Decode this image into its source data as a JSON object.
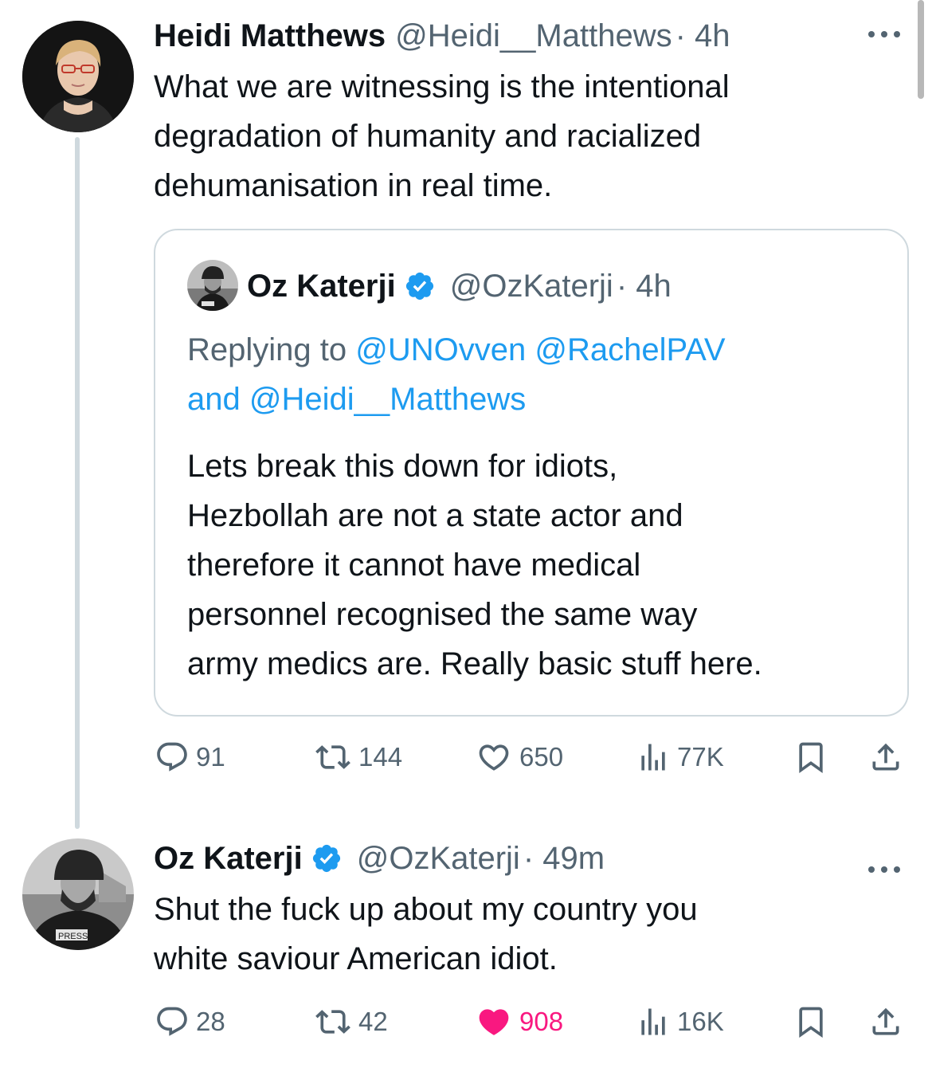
{
  "tweet1": {
    "display_name": "Heidi Matthews",
    "handle": "@Heidi__Matthews",
    "time": "· 4h",
    "more_icon": "more-horizontal-icon",
    "text_lines": [
      "What we are witnessing is the intentional",
      "degradation of humanity and racialized",
      "dehumanisation in real time."
    ],
    "quote": {
      "display_name": "Oz Katerji",
      "handle": "@OzKaterji",
      "time": "· 4h",
      "verified_icon": "verified-badge-icon",
      "replying_prefix": "Replying to",
      "replying_to_line1": "@UNOvven @RachelPAV",
      "replying_and": "and",
      "replying_to_line2": "@Heidi__Matthews",
      "text_lines": [
        "Lets break this down for idiots,",
        "Hezbollah are not a state actor and",
        "therefore it cannot have medical",
        "personnel recognised the same way",
        "army medics are. Really basic stuff here."
      ]
    },
    "metrics": {
      "replies": "91",
      "reposts": "144",
      "likes": "650",
      "views": "77K"
    }
  },
  "tweet2": {
    "display_name": "Oz Katerji",
    "handle": "@OzKaterji",
    "time": "· 49m",
    "verified_icon": "verified-badge-icon",
    "more_icon": "more-horizontal-icon",
    "avatar_badge": "PRESS",
    "text_lines": [
      "Shut the fuck up about my country you",
      "white saviour American idiot."
    ],
    "metrics": {
      "replies": "28",
      "reposts": "42",
      "likes": "908",
      "views": "16K",
      "liked": true
    }
  },
  "colors": {
    "text": "#0f1419",
    "muted": "#536471",
    "link": "#1d9bf0",
    "verified": "#1d9bf0",
    "like_active": "#f91880",
    "border": "#cfd9de"
  }
}
